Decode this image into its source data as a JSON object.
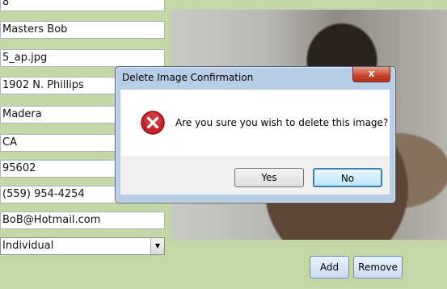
{
  "form": {
    "fields": [
      {
        "name": "id-field",
        "value": "8"
      },
      {
        "name": "name-field",
        "value": "Masters Bob"
      },
      {
        "name": "image-file-field",
        "value": "5_ap.jpg"
      },
      {
        "name": "address-field",
        "value": "1902 N. Phillips"
      },
      {
        "name": "city-field",
        "value": "Madera"
      },
      {
        "name": "state-field",
        "value": "CA"
      },
      {
        "name": "zip-field",
        "value": "95602"
      },
      {
        "name": "phone-field",
        "value": "(559) 954-4254"
      },
      {
        "name": "email-field",
        "value": "BoB@Hotmail.com"
      }
    ],
    "type_select": {
      "value": "Individual"
    }
  },
  "buttons": {
    "add": "Add",
    "remove": "Remove"
  },
  "dialog": {
    "title": "Delete Image Confirmation",
    "close_glyph": "x",
    "message": "Are you sure you wish to delete this image?",
    "yes": "Yes",
    "no": "No"
  },
  "colors": {
    "background": "#c4d7a7",
    "error": "#c8232b"
  }
}
